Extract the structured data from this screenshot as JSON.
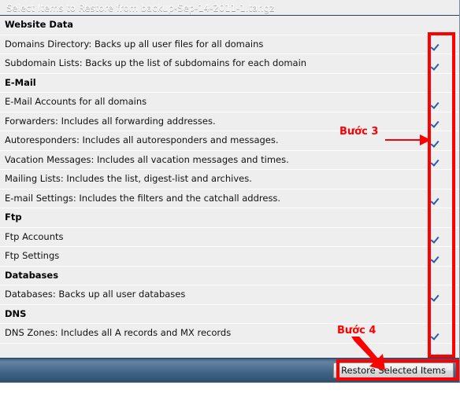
{
  "window": {
    "title": "Select Items to Restore from backup-Sep-14-2011-1.tar.gz"
  },
  "list": {
    "rows": [
      {
        "type": "group",
        "label": "Website Data",
        "checkbox": null
      },
      {
        "type": "item",
        "label": "Domains Directory: Backs up all user files for all domains",
        "checkbox": "checked"
      },
      {
        "type": "item",
        "label": "Subdomain Lists: Backs up the list of subdomains for each domain",
        "checkbox": "checked"
      },
      {
        "type": "group",
        "label": "E-Mail",
        "checkbox": null
      },
      {
        "type": "item",
        "label": "E-Mail Accounts for all domains",
        "checkbox": "checked"
      },
      {
        "type": "item",
        "label": "Forwarders: Includes all forwarding addresses.",
        "checkbox": "checked"
      },
      {
        "type": "item",
        "label": "Autoresponders: Includes all autoresponders and messages.",
        "checkbox": "checked"
      },
      {
        "type": "item",
        "label": "Vacation Messages: Includes all vacation messages and times.",
        "checkbox": "checked"
      },
      {
        "type": "item",
        "label": "Mailing Lists: Includes the list, digest-list and archives.",
        "checkbox": "unchecked"
      },
      {
        "type": "item",
        "label": "E-mail Settings: Includes the filters and the catchall address.",
        "checkbox": "checked"
      },
      {
        "type": "group",
        "label": "Ftp",
        "checkbox": null
      },
      {
        "type": "item",
        "label": "Ftp Accounts",
        "checkbox": "checked"
      },
      {
        "type": "item",
        "label": "Ftp Settings",
        "checkbox": "checked"
      },
      {
        "type": "group",
        "label": "Databases",
        "checkbox": null
      },
      {
        "type": "item",
        "label": "Databases: Backs up all user databases",
        "checkbox": "checked"
      },
      {
        "type": "group",
        "label": "DNS",
        "checkbox": null
      },
      {
        "type": "item",
        "label": "DNS Zones: Includes all A records and MX records",
        "checkbox": "checked"
      }
    ]
  },
  "footer": {
    "restore_button_label": "Restore Selected Items"
  },
  "annotations": {
    "step3_label": "Bước 3",
    "step4_label": "Bước 4",
    "color": "#fe0000"
  },
  "colors": {
    "titlebar": "#3d5d80",
    "footer": "#3f6386",
    "row_background": "#eeeeee",
    "checkmark": "#2a5caa",
    "annotation_red": "#fe0000"
  }
}
